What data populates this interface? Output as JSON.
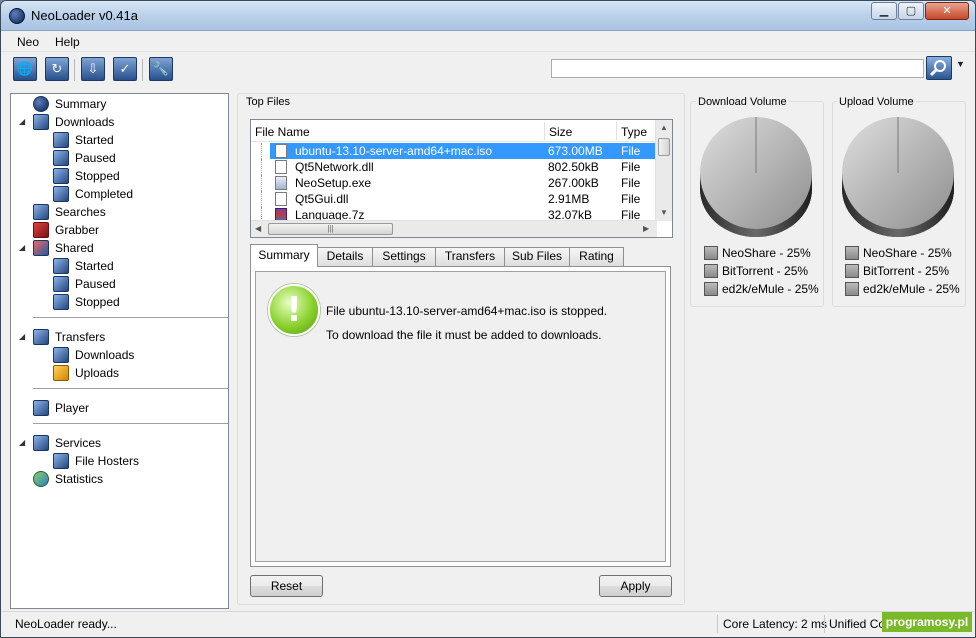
{
  "window": {
    "title": "NeoLoader v0.41a",
    "controls": {
      "minimize": "▁",
      "maximize": "▢",
      "close": "✕"
    }
  },
  "menu": {
    "items": [
      "Neo",
      "Help"
    ]
  },
  "toolbar": {
    "buttons": [
      {
        "name": "add-url-icon",
        "glyph": "🌐"
      },
      {
        "name": "refresh-icon",
        "glyph": "↻"
      },
      {
        "name": "download-icon",
        "glyph": "⇩"
      },
      {
        "name": "checkmark-icon",
        "glyph": "✓"
      },
      {
        "name": "wrench-icon",
        "glyph": "🔧"
      }
    ],
    "search": {
      "value": "",
      "placeholder": ""
    }
  },
  "sidebar": {
    "items": [
      {
        "label": "Summary",
        "icon": "summary-icon"
      },
      {
        "label": "Downloads",
        "icon": "downloads-icon"
      },
      {
        "label": "Started",
        "icon": "started-icon"
      },
      {
        "label": "Paused",
        "icon": "paused-icon"
      },
      {
        "label": "Stopped",
        "icon": "stopped-icon"
      },
      {
        "label": "Completed",
        "icon": "completed-icon"
      },
      {
        "label": "Searches",
        "icon": "searches-icon"
      },
      {
        "label": "Grabber",
        "icon": "grabber-icon"
      },
      {
        "label": "Shared",
        "icon": "shared-icon"
      },
      {
        "label": "Started",
        "icon": "started-icon"
      },
      {
        "label": "Paused",
        "icon": "paused-icon"
      },
      {
        "label": "Stopped",
        "icon": "stopped-icon"
      },
      {
        "label": "Transfers",
        "icon": "transfers-icon"
      },
      {
        "label": "Downloads",
        "icon": "downloads-icon"
      },
      {
        "label": "Uploads",
        "icon": "uploads-icon"
      },
      {
        "label": "Player",
        "icon": "player-icon"
      },
      {
        "label": "Services",
        "icon": "services-icon"
      },
      {
        "label": "File Hosters",
        "icon": "file-hosters-icon"
      },
      {
        "label": "Statistics",
        "icon": "statistics-icon"
      }
    ]
  },
  "top_files": {
    "title": "Top Files",
    "columns": [
      "File Name",
      "Size",
      "Type"
    ],
    "rows": [
      {
        "name": "ubuntu-13.10-server-amd64+mac.iso",
        "size": "673.00MB",
        "type": "File",
        "selected": true
      },
      {
        "name": "Qt5Network.dll",
        "size": "802.50kB",
        "type": "File"
      },
      {
        "name": "NeoSetup.exe",
        "size": "267.00kB",
        "type": "File"
      },
      {
        "name": "Qt5Gui.dll",
        "size": "2.91MB",
        "type": "File"
      },
      {
        "name": "Language.7z",
        "size": "32.07kB",
        "type": "File"
      }
    ]
  },
  "tabs": [
    "Summary",
    "Details",
    "Settings",
    "Transfers",
    "Sub Files",
    "Rating"
  ],
  "summary": {
    "icon_glyph": "!",
    "line1": "File ubuntu-13.10-server-amd64+mac.iso is stopped.",
    "line2": "To download the file it must be added to downloads."
  },
  "buttons": {
    "reset": "Reset",
    "apply": "Apply"
  },
  "download_volume": {
    "title": "Download Volume",
    "legend": [
      "NeoShare - 25%",
      "BitTorrent - 25%",
      "ed2k/eMule - 25%"
    ]
  },
  "upload_volume": {
    "title": "Upload Volume",
    "legend": [
      "NeoShare - 25%",
      "BitTorrent - 25%",
      "ed2k/eMule - 25%"
    ]
  },
  "statusbar": {
    "message": "NeoLoader ready...",
    "latency": "Core Latency: 2 ms",
    "unified": "Unified Co"
  },
  "watermark": "programosy.pl"
}
